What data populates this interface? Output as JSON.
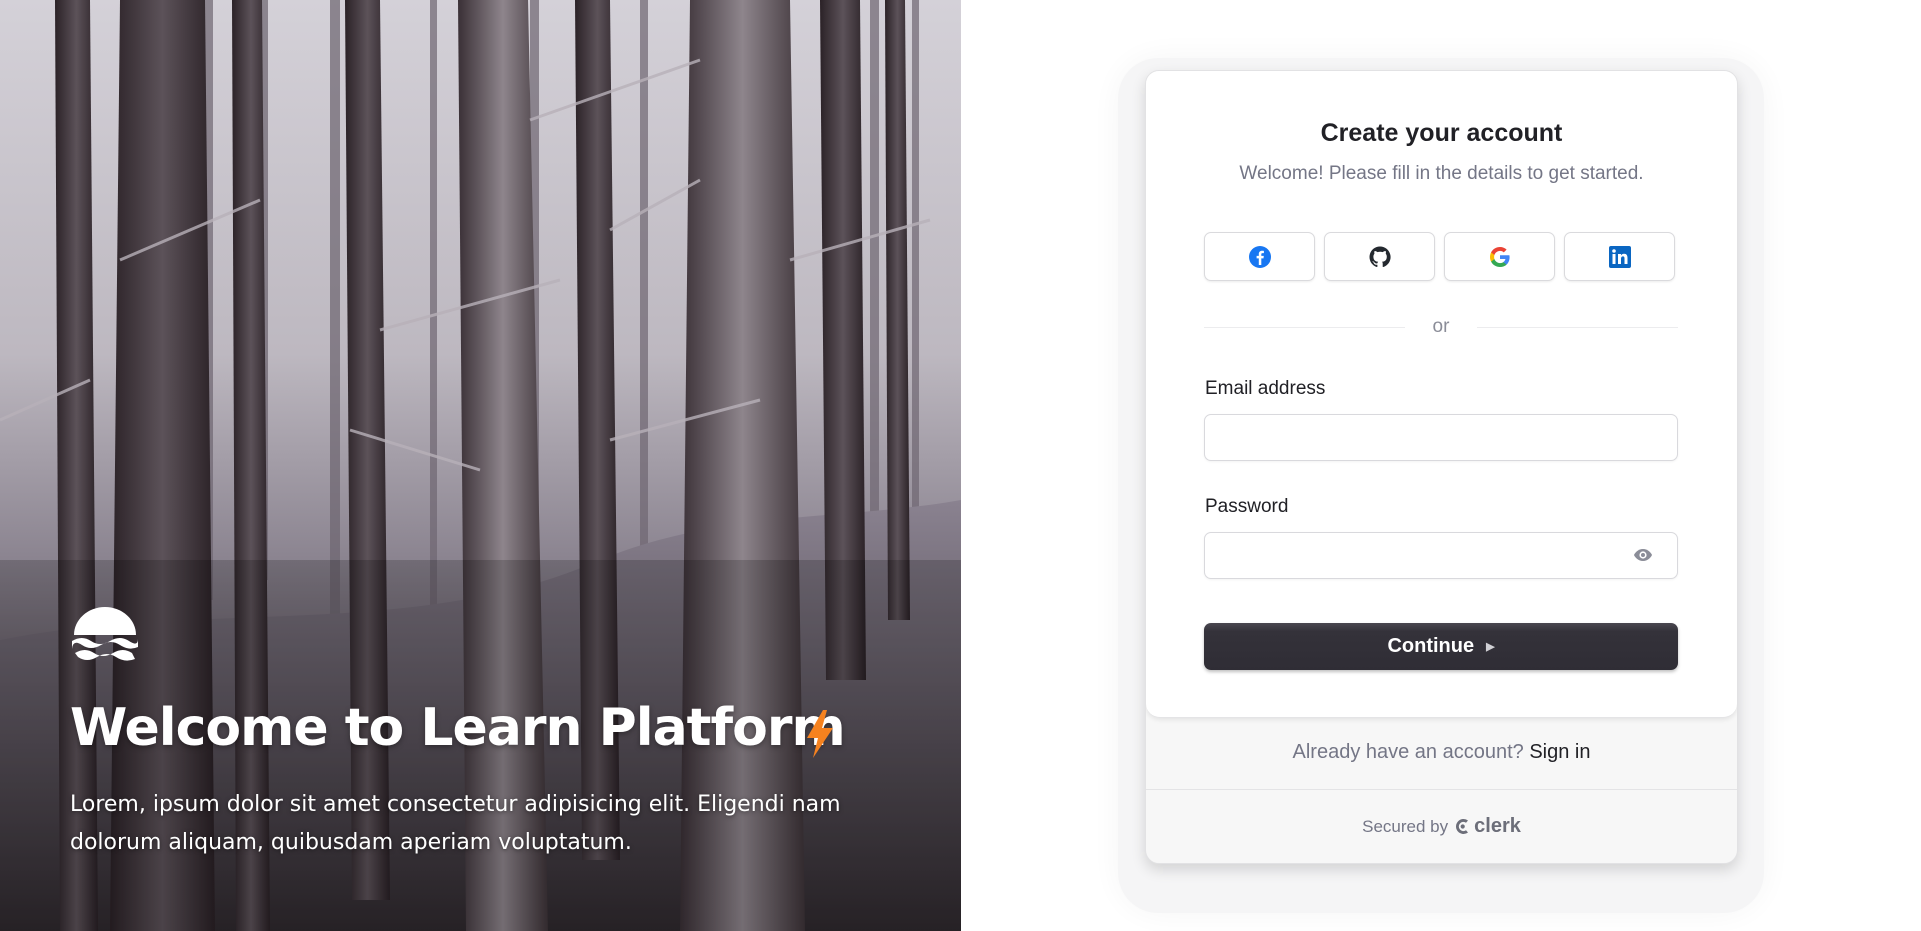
{
  "hero": {
    "title": "Welcome to Learn Platform",
    "description": "Lorem, ipsum dolor sit amet consectetur adipisicing elit. Eligendi nam dolorum aliquam, quibusdam aperiam voluptatum.",
    "logo_icon": "sun-waves-logo-icon",
    "accent_icon": "lightning-bolt-icon",
    "accent_color": "#f6821f"
  },
  "auth": {
    "title": "Create your account",
    "subtitle": "Welcome! Please fill in the details to get started.",
    "social_providers": [
      {
        "name": "Facebook",
        "icon": "facebook-icon",
        "color": "#1877f2"
      },
      {
        "name": "GitHub",
        "icon": "github-icon",
        "color": "#24292f"
      },
      {
        "name": "Google",
        "icon": "google-icon",
        "color": "#4285f4"
      },
      {
        "name": "LinkedIn",
        "icon": "linkedin-icon",
        "color": "#0a66c2"
      }
    ],
    "divider_text": "or",
    "email": {
      "label": "Email address",
      "value": "",
      "placeholder": ""
    },
    "password": {
      "label": "Password",
      "value": "",
      "placeholder": "",
      "toggle_icon": "eye-icon"
    },
    "continue_label": "Continue",
    "footer": {
      "prompt": "Already have an account?",
      "sign_in_label": "Sign in",
      "secured_by": "Secured by",
      "brand": "clerk"
    }
  }
}
